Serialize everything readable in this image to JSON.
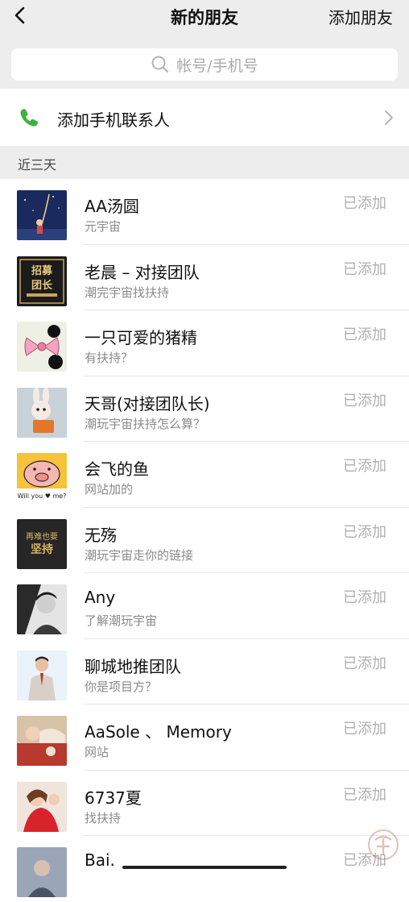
{
  "header": {
    "title": "新的朋友",
    "action_label": "添加朋友"
  },
  "search": {
    "placeholder": "帐号/手机号"
  },
  "add_phone_contacts": {
    "label": "添加手机联系人",
    "icon": "phone-icon"
  },
  "section": {
    "label": "近三天"
  },
  "friends": [
    {
      "name": "AA汤圆",
      "message": "元宇宙",
      "status": "已添加"
    },
    {
      "name": "老晨 – 对接团队",
      "message": "潮完宇宙找扶持",
      "status": "已添加"
    },
    {
      "name": "一只可爱的猪精",
      "message": "有扶持？",
      "status": "已添加"
    },
    {
      "name": "天哥(对接团队长)",
      "message": "潮玩宇宙扶持怎么算？",
      "status": "已添加"
    },
    {
      "name": "会飞的鱼",
      "message": "网站加的",
      "status": "已添加"
    },
    {
      "name": "无殇",
      "message": "潮玩宇宙走你的链接",
      "status": "已添加"
    },
    {
      "name": "Any",
      "message": "了解潮玩宇宙",
      "status": "已添加"
    },
    {
      "name": "聊城地推团队",
      "message": "你是项目方？",
      "status": "已添加"
    },
    {
      "name": "AaSole 、 Memory",
      "message": "网站",
      "status": "已添加"
    },
    {
      "name": "6737夏",
      "message": "找扶持",
      "status": "已添加"
    },
    {
      "name": "Bai.",
      "message": "",
      "status": "已添加"
    }
  ],
  "avatar_texts": {
    "recruit_1": "招募",
    "recruit_2": "团长",
    "pig": "Will you ♥ me?",
    "persist_1": "再难也要",
    "persist_2": "坚持"
  },
  "colors": {
    "topbar_bg": "#ededed",
    "phone_green": "#3bb13e",
    "status_gray": "#b0b0b0"
  }
}
